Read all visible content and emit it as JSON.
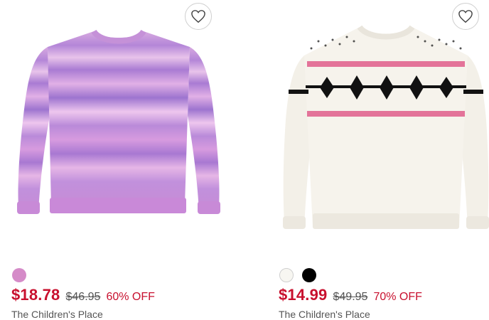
{
  "products": [
    {
      "swatches": [
        "#d58bc8"
      ],
      "price": "$18.78",
      "original_price": "$46.95",
      "discount": "60% OFF",
      "brand": "The Children's Place"
    },
    {
      "swatches": [
        "#f7f6f1",
        "#000000"
      ],
      "price": "$14.99",
      "original_price": "$49.95",
      "discount": "70% OFF",
      "brand": "The Children's Place"
    }
  ],
  "icons": {
    "wishlist": "heart-outline-icon"
  },
  "colors": {
    "sale": "#c8102e"
  }
}
